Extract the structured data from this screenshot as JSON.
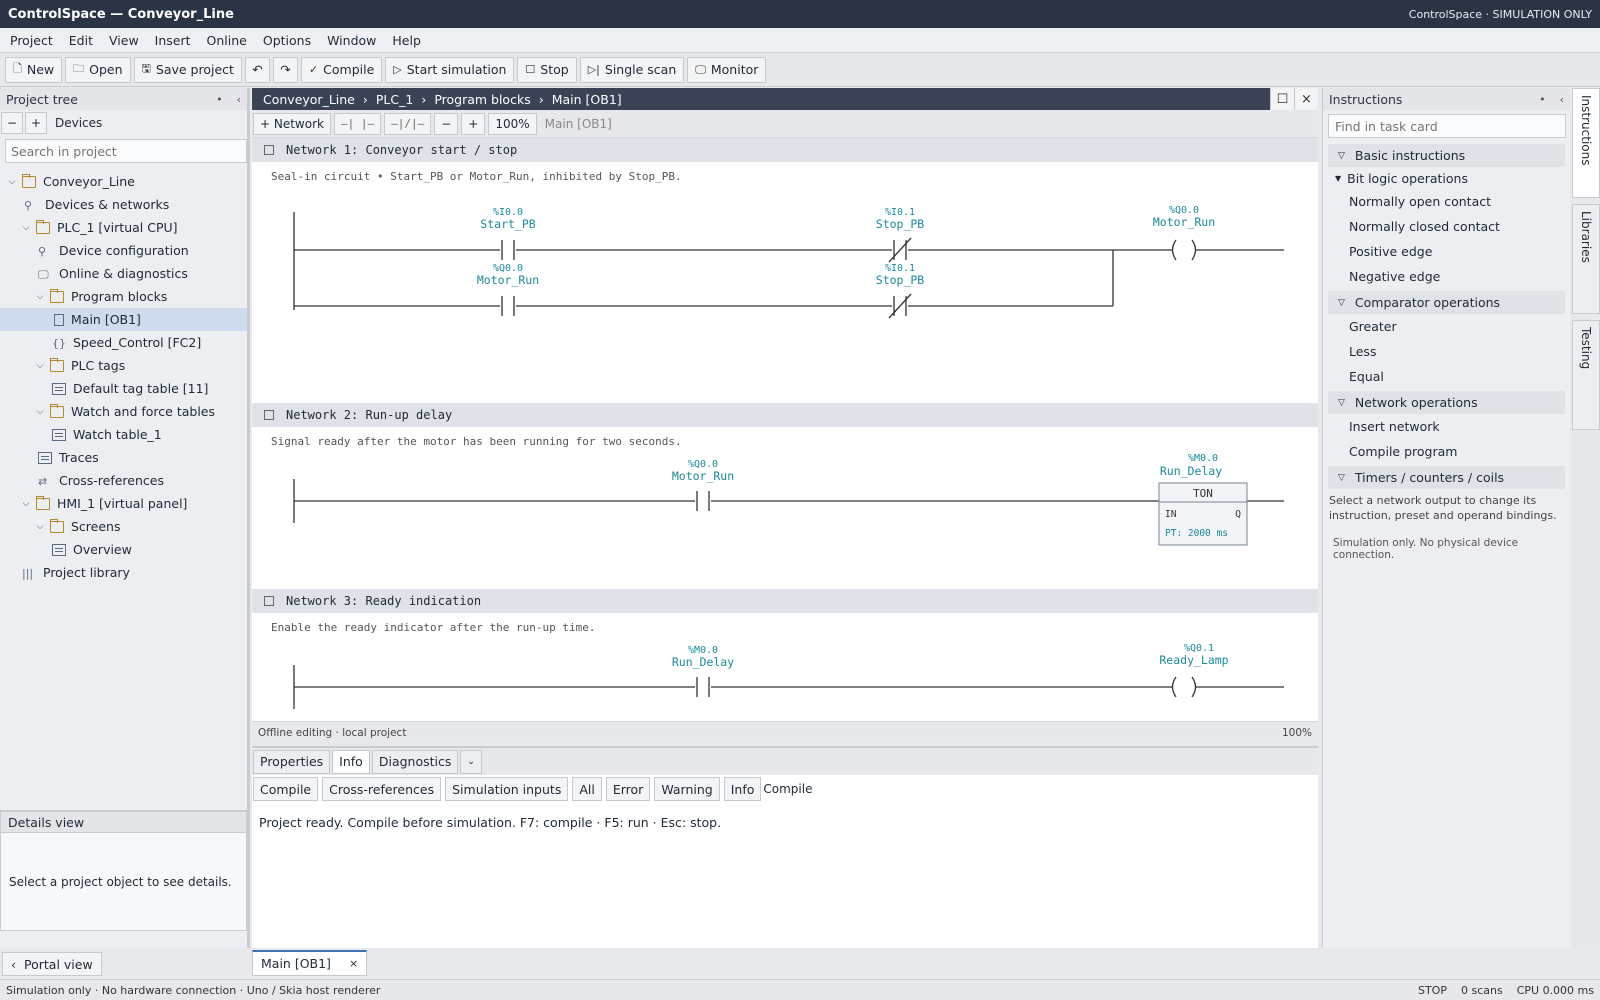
{
  "titlebar": {
    "title": "ControlSpace — Conveyor_Line",
    "right": "ControlSpace · SIMULATION ONLY"
  },
  "menu": [
    "Project",
    "Edit",
    "View",
    "Insert",
    "Online",
    "Options",
    "Window",
    "Help"
  ],
  "toolbar": {
    "new": "New",
    "open": "Open",
    "save": "Save project",
    "compile": "Compile",
    "start": "Start simulation",
    "stop": "Stop",
    "single": "Single scan",
    "monitor": "Monitor"
  },
  "project_tree": {
    "title": "Project tree",
    "devices_label": "Devices",
    "search_placeholder": "Search in project",
    "items": [
      {
        "label": "Conveyor_Line"
      },
      {
        "label": "Devices & networks"
      },
      {
        "label": "PLC_1 [virtual CPU]"
      },
      {
        "label": "Device configuration"
      },
      {
        "label": "Online & diagnostics"
      },
      {
        "label": "Program blocks"
      },
      {
        "label": "Main [OB1]"
      },
      {
        "label": "Speed_Control [FC2]"
      },
      {
        "label": "PLC tags"
      },
      {
        "label": "Default tag table [11]"
      },
      {
        "label": "Watch and force tables"
      },
      {
        "label": "Watch table_1"
      },
      {
        "label": "Traces"
      },
      {
        "label": "Cross-references"
      },
      {
        "label": "HMI_1 [virtual panel]"
      },
      {
        "label": "Screens"
      },
      {
        "label": "Overview"
      },
      {
        "label": "Project library"
      }
    ]
  },
  "details": {
    "title": "Details view",
    "text": "Select a project object to see details."
  },
  "portal": "Portal view",
  "editor": {
    "breadcrumb": [
      "Conveyor_Line",
      "PLC_1",
      "Program blocks",
      "Main [OB1]"
    ],
    "network_btn": "+ Network",
    "contact_no": "—| |—",
    "contact_nc": "—|/|—",
    "zoom_minus": "−",
    "zoom_plus": "+",
    "zoom": "100%",
    "block": "Main [OB1]",
    "networks": [
      {
        "title": "Network 1:  Conveyor start / stop",
        "comment": "Seal-in circuit • Start_PB or Motor_Run, inhibited by Stop_PB.",
        "c1a": "%I0.0",
        "c1b": "Start_PB",
        "c2a": "%I0.1",
        "c2b": "Stop_PB",
        "q1a": "%Q0.0",
        "q1b": "Motor_Run",
        "c3a": "%Q0.0",
        "c3b": "Motor_Run",
        "c4a": "%I0.1",
        "c4b": "Stop_PB"
      },
      {
        "title": "Network 2:  Run-up delay",
        "comment": "Signal ready after the motor has been running for two seconds.",
        "c1a": "%Q0.0",
        "c1b": "Motor_Run",
        "t1a": "%M0.0",
        "t1b": "Run_Delay",
        "tname": "TON",
        "tin": "IN",
        "tq": "Q",
        "tpt": "PT: 2000 ms"
      },
      {
        "title": "Network 3:  Ready indication",
        "comment": "Enable the ready indicator after the run-up time.",
        "c1a": "%M0.0",
        "c1b": "Run_Delay",
        "q1a": "%Q0.1",
        "q1b": "Ready_Lamp"
      }
    ],
    "status_left": "Offline editing  ·  local project",
    "status_right": "100%"
  },
  "bottom": {
    "tabs": [
      "Properties",
      "Info",
      "Diagnostics"
    ],
    "filters": [
      "Compile",
      "Cross-references",
      "Simulation inputs",
      "All",
      "Error",
      "Warning",
      "Info"
    ],
    "filter_label": "Compile",
    "message": "Project ready. Compile before simulation. F7: compile · F5: run · Esc: stop."
  },
  "instructions": {
    "title": "Instructions",
    "find_placeholder": "Find in task card",
    "basic": "Basic instructions",
    "bitlogic": "Bit logic operations",
    "bit_items": [
      "Normally open contact",
      "Normally closed contact",
      "Positive edge",
      "Negative edge"
    ],
    "comparator": "Comparator operations",
    "comp_items": [
      "Greater",
      "Less",
      "Equal"
    ],
    "network_ops": "Network operations",
    "net_items": [
      "Insert network",
      "Compile program"
    ],
    "timers": "Timers / counters / coils",
    "note": "Select a network output to change its instruction, preset and operand bindings.",
    "note2": "Simulation only. No physical device connection."
  },
  "side_tabs": [
    "Instructions",
    "Libraries",
    "Testing"
  ],
  "open_tab": "Main [OB1]",
  "statusbar": {
    "left": "Simulation only · No hardware connection · Uno / Skia host renderer",
    "mode": "STOP",
    "scans": "0 scans",
    "cpu": "CPU 0.000 ms"
  },
  "colors": {
    "operand": "#1a8a9a",
    "titlebar": "#2b3445",
    "selection": "#cfdcee"
  }
}
